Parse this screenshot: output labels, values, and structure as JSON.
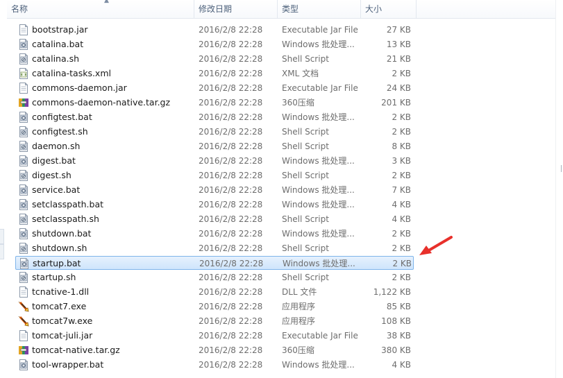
{
  "columns": {
    "name": "名称",
    "date": "修改日期",
    "type": "类型",
    "size": "大小"
  },
  "colors": {
    "selection_fill": "#cfe5fc",
    "selection_border": "#7eb4ea",
    "annotation_arrow": "#e8302b"
  },
  "files": [
    {
      "name": "bootstrap.jar",
      "date": "2016/2/8 22:28",
      "type": "Executable Jar File",
      "size": "27 KB",
      "icon": "jar-file-icon"
    },
    {
      "name": "catalina.bat",
      "date": "2016/2/8 22:28",
      "type": "Windows 批处理...",
      "size": "13 KB",
      "icon": "batch-file-icon"
    },
    {
      "name": "catalina.sh",
      "date": "2016/2/8 22:28",
      "type": "Shell Script",
      "size": "21 KB",
      "icon": "script-file-icon"
    },
    {
      "name": "catalina-tasks.xml",
      "date": "2016/2/8 22:28",
      "type": "XML 文档",
      "size": "2 KB",
      "icon": "xml-file-icon"
    },
    {
      "name": "commons-daemon.jar",
      "date": "2016/2/8 22:28",
      "type": "Executable Jar File",
      "size": "24 KB",
      "icon": "jar-file-icon"
    },
    {
      "name": "commons-daemon-native.tar.gz",
      "date": "2016/2/8 22:28",
      "type": "360压缩",
      "size": "201 KB",
      "icon": "archive-file-icon"
    },
    {
      "name": "configtest.bat",
      "date": "2016/2/8 22:28",
      "type": "Windows 批处理...",
      "size": "2 KB",
      "icon": "batch-file-icon"
    },
    {
      "name": "configtest.sh",
      "date": "2016/2/8 22:28",
      "type": "Shell Script",
      "size": "2 KB",
      "icon": "script-file-icon"
    },
    {
      "name": "daemon.sh",
      "date": "2016/2/8 22:28",
      "type": "Shell Script",
      "size": "8 KB",
      "icon": "script-file-icon"
    },
    {
      "name": "digest.bat",
      "date": "2016/2/8 22:28",
      "type": "Windows 批处理...",
      "size": "3 KB",
      "icon": "batch-file-icon"
    },
    {
      "name": "digest.sh",
      "date": "2016/2/8 22:28",
      "type": "Shell Script",
      "size": "2 KB",
      "icon": "script-file-icon"
    },
    {
      "name": "service.bat",
      "date": "2016/2/8 22:28",
      "type": "Windows 批处理...",
      "size": "7 KB",
      "icon": "batch-file-icon"
    },
    {
      "name": "setclasspath.bat",
      "date": "2016/2/8 22:28",
      "type": "Windows 批处理...",
      "size": "4 KB",
      "icon": "batch-file-icon"
    },
    {
      "name": "setclasspath.sh",
      "date": "2016/2/8 22:28",
      "type": "Shell Script",
      "size": "4 KB",
      "icon": "script-file-icon"
    },
    {
      "name": "shutdown.bat",
      "date": "2016/2/8 22:28",
      "type": "Windows 批处理...",
      "size": "2 KB",
      "icon": "batch-file-icon"
    },
    {
      "name": "shutdown.sh",
      "date": "2016/2/8 22:28",
      "type": "Shell Script",
      "size": "2 KB",
      "icon": "script-file-icon"
    },
    {
      "name": "startup.bat",
      "date": "2016/2/8 22:28",
      "type": "Windows 批处理...",
      "size": "2 KB",
      "icon": "batch-file-icon",
      "selected": true
    },
    {
      "name": "startup.sh",
      "date": "2016/2/8 22:28",
      "type": "Shell Script",
      "size": "2 KB",
      "icon": "script-file-icon"
    },
    {
      "name": "tcnative-1.dll",
      "date": "2016/2/8 22:28",
      "type": "DLL 文件",
      "size": "1,122 KB",
      "icon": "dll-file-icon"
    },
    {
      "name": "tomcat7.exe",
      "date": "2016/2/8 22:28",
      "type": "应用程序",
      "size": "85 KB",
      "icon": "tomcat-exe-icon"
    },
    {
      "name": "tomcat7w.exe",
      "date": "2016/2/8 22:28",
      "type": "应用程序",
      "size": "108 KB",
      "icon": "tomcat-exe-icon"
    },
    {
      "name": "tomcat-juli.jar",
      "date": "2016/2/8 22:28",
      "type": "Executable Jar File",
      "size": "38 KB",
      "icon": "jar-file-icon"
    },
    {
      "name": "tomcat-native.tar.gz",
      "date": "2016/2/8 22:28",
      "type": "360压缩",
      "size": "380 KB",
      "icon": "archive-file-icon"
    },
    {
      "name": "tool-wrapper.bat",
      "date": "2016/2/8 22:28",
      "type": "Windows 批处理...",
      "size": "4 KB",
      "icon": "batch-file-icon"
    }
  ]
}
